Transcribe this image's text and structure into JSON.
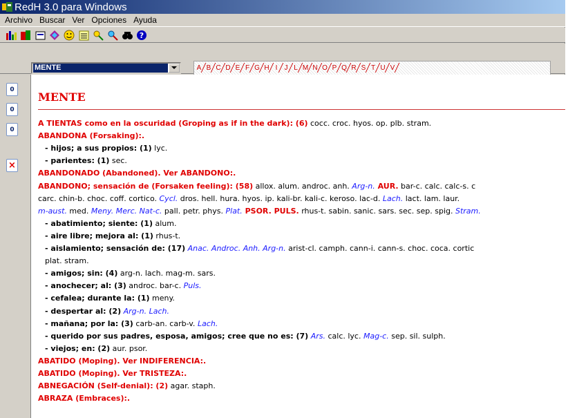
{
  "window": {
    "title": "RedH 3.0 para Windows"
  },
  "menu": [
    "Archivo",
    "Buscar",
    "Ver",
    "Opciones",
    "Ayuda"
  ],
  "toolbar_icons": [
    "chart-icon",
    "chart2-icon",
    "print-icon",
    "diamond-icon",
    "smiley-icon",
    "list-icon",
    "search-pencil-icon",
    "search-plus-icon",
    "binoculars-icon",
    "help-icon"
  ],
  "combo": {
    "value": "MENTE"
  },
  "letters": [
    "A",
    "B",
    "C",
    "D",
    "E",
    "F",
    "G",
    "H",
    "I",
    "J",
    "L",
    "M",
    "N",
    "O",
    "P",
    "Q",
    "R",
    "S",
    "T",
    "U",
    "V"
  ],
  "side_buttons": [
    {
      "name": "document-icon-1",
      "label": "0"
    },
    {
      "name": "document-icon-2",
      "label": "0"
    },
    {
      "name": "document-icon-3",
      "label": "0"
    },
    {
      "name": "delete-document-icon",
      "label": "×"
    }
  ],
  "heading": "MENTE",
  "lines": [
    {
      "type": "rubric",
      "text": "A TIENTAS como en la oscuridad (Groping as if in the dark): (6)",
      "remedies": [
        {
          "t": " cocc. croc. hyos. op. plb. stram.",
          "s": "rem"
        }
      ]
    },
    {
      "type": "rubric",
      "text": "ABANDONA (Forsaking):.",
      "remedies": []
    },
    {
      "type": "sub",
      "text": "- hijos; a sus propios: (1)",
      "remedies": [
        {
          "t": " lyc.",
          "s": "rem"
        }
      ]
    },
    {
      "type": "sub",
      "text": "- parientes: (1)",
      "remedies": [
        {
          "t": " sec.",
          "s": "rem"
        }
      ]
    },
    {
      "type": "rubric",
      "text": "ABANDONADO (Abandoned). Ver ABANDONO:.",
      "remedies": []
    },
    {
      "type": "rubric",
      "text": "ABANDONO; sensación de (Forsaken feeling): (58)",
      "remedies": [
        {
          "t": " allox. alum. androc. anh. ",
          "s": "rem"
        },
        {
          "t": "Arg-n.",
          "s": "rem2"
        },
        {
          "t": " AUR.",
          "s": "rem3"
        },
        {
          "t": " bar-c. calc. calc-s. c",
          "s": "rem"
        }
      ]
    },
    {
      "type": "cont",
      "text": "",
      "remedies": [
        {
          "t": "carc. chin-b. choc. coff. cortico. ",
          "s": "rem"
        },
        {
          "t": "Cycl.",
          "s": "rem2"
        },
        {
          "t": " dros. hell. hura. hyos. ip. kali-br. kali-c. keroso. lac-d. ",
          "s": "rem"
        },
        {
          "t": "Lach.",
          "s": "rem2"
        },
        {
          "t": " lact. lam. laur.",
          "s": "rem"
        }
      ]
    },
    {
      "type": "cont",
      "text": "",
      "remedies": [
        {
          "t": "m-aust.",
          "s": "rem2"
        },
        {
          "t": " med. ",
          "s": "rem"
        },
        {
          "t": "Meny. Merc. Nat-c.",
          "s": "rem2"
        },
        {
          "t": " pall. petr. phys. ",
          "s": "rem"
        },
        {
          "t": "Plat.",
          "s": "rem2"
        },
        {
          "t": " PSOR. PULS.",
          "s": "rem3"
        },
        {
          "t": " rhus-t. sabin. sanic. sars. sec. sep. spig. ",
          "s": "rem"
        },
        {
          "t": "Stram.",
          "s": "rem2"
        }
      ]
    },
    {
      "type": "sub",
      "text": "- abatimiento; siente: (1)",
      "remedies": [
        {
          "t": " alum.",
          "s": "rem"
        }
      ]
    },
    {
      "type": "sub",
      "text": "- aire libre; mejora al: (1)",
      "remedies": [
        {
          "t": " rhus-t.",
          "s": "rem"
        }
      ]
    },
    {
      "type": "sub",
      "text": "- aislamiento; sensación de: (17)",
      "remedies": [
        {
          "t": " Anac. Androc. Anh. Arg-n.",
          "s": "rem2"
        },
        {
          "t": " arist-cl. camph. cann-i. cann-s. choc. coca. cortic",
          "s": "rem"
        }
      ]
    },
    {
      "type": "cont2",
      "text": "",
      "remedies": [
        {
          "t": "plat. stram.",
          "s": "rem"
        }
      ]
    },
    {
      "type": "sub",
      "text": "- amigos; sin: (4)",
      "remedies": [
        {
          "t": " arg-n. lach. mag-m. sars.",
          "s": "rem"
        }
      ]
    },
    {
      "type": "sub",
      "text": "- anochecer; al: (3)",
      "remedies": [
        {
          "t": " androc. bar-c. ",
          "s": "rem"
        },
        {
          "t": "Puls.",
          "s": "rem2"
        }
      ]
    },
    {
      "type": "sub",
      "text": "- cefalea; durante la: (1)",
      "remedies": [
        {
          "t": " meny.",
          "s": "rem"
        }
      ]
    },
    {
      "type": "sub",
      "text": "- despertar al: (2)",
      "remedies": [
        {
          "t": " Arg-n. Lach.",
          "s": "rem2"
        }
      ]
    },
    {
      "type": "sub",
      "text": "- mañana; por la: (3)",
      "remedies": [
        {
          "t": " carb-an. carb-v. ",
          "s": "rem"
        },
        {
          "t": "Lach.",
          "s": "rem2"
        }
      ]
    },
    {
      "type": "sub",
      "text": "- querido por sus padres, esposa, amigos; cree que no es: (7)",
      "remedies": [
        {
          "t": " Ars.",
          "s": "rem2"
        },
        {
          "t": " calc. lyc. ",
          "s": "rem"
        },
        {
          "t": "Mag-c.",
          "s": "rem2"
        },
        {
          "t": " sep. sil. sulph.",
          "s": "rem"
        }
      ]
    },
    {
      "type": "sub",
      "text": "- viejos; en: (2)",
      "remedies": [
        {
          "t": " aur. psor.",
          "s": "rem"
        }
      ]
    },
    {
      "type": "rubric",
      "text": "ABATIDO (Moping). Ver INDIFERENCIA:.",
      "remedies": []
    },
    {
      "type": "rubric",
      "text": "ABATIDO (Moping). Ver TRISTEZA:.",
      "remedies": []
    },
    {
      "type": "rubric",
      "text": "ABNEGACIÓN (Self-denial): (2)",
      "remedies": [
        {
          "t": " agar. staph.",
          "s": "rem"
        }
      ]
    },
    {
      "type": "rubric",
      "text": "ABRAZA (Embraces):.",
      "remedies": []
    }
  ]
}
